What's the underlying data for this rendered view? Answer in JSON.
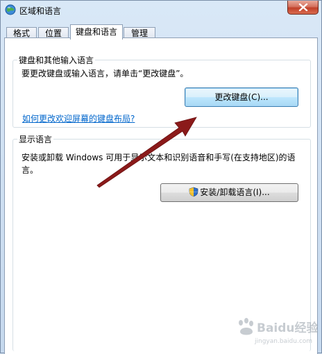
{
  "window": {
    "title": "区域和语言"
  },
  "tabs": [
    {
      "label": "格式"
    },
    {
      "label": "位置"
    },
    {
      "label": "键盘和语言",
      "active": true
    },
    {
      "label": "管理"
    }
  ],
  "keyboard_group": {
    "title": "键盘和其他输入语言",
    "description": "要更改键盘或输入语言，请单击“更改键盘”。",
    "change_button": "更改键盘(C)...",
    "link": "如何更改欢迎屏幕的键盘布局?"
  },
  "display_group": {
    "title": "显示语言",
    "description_line1": "安装或卸载 Windows 可用于显示文本和识别语音和手写(在支持地区)的语",
    "description_line2": "言。",
    "install_button": "安装/卸载语言(I)..."
  },
  "watermark": {
    "text": "Baidu经验",
    "url_text": "jingyan.baidu.com"
  },
  "colors": {
    "link": "#0066cc",
    "arrow": "#8b1a1a",
    "close": "#c0412a"
  }
}
